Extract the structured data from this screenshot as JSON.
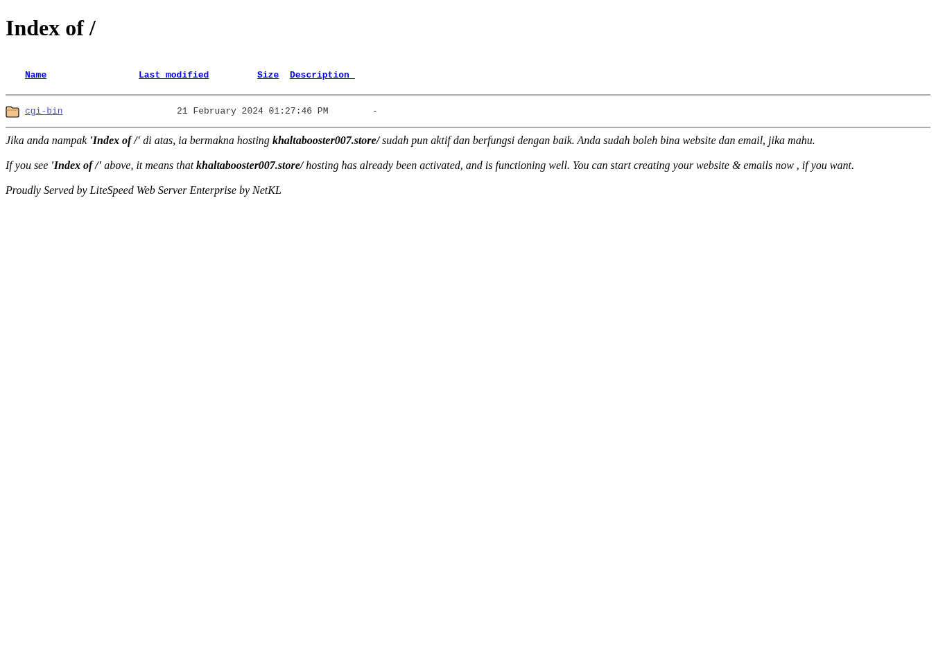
{
  "title": "Index of /",
  "columns": [
    "Name",
    "Last modified",
    "Size",
    "Description "
  ],
  "rows": [
    {
      "kind": "directory",
      "name": "cgi-bin",
      "modified": "21 February 2024 01:27:46 PM",
      "size": "-"
    }
  ],
  "notes": [
    "Jika anda nampak **'Index of /'** di atas, ia bermakna hosting **khaltabooster007.store/** sudah pun aktif dan berfungsi dengan baik. Anda sudah boleh bina website dan email, jika mahu.",
    "If you see **'Index of /'** above, it means that **khaltabooster007.store/** hosting has already been activated, and is functioning well. You can start creating your website & emails now , if you want.",
    "Proudly Served by LiteSpeed Web Server Enterprise by NetKL"
  ]
}
